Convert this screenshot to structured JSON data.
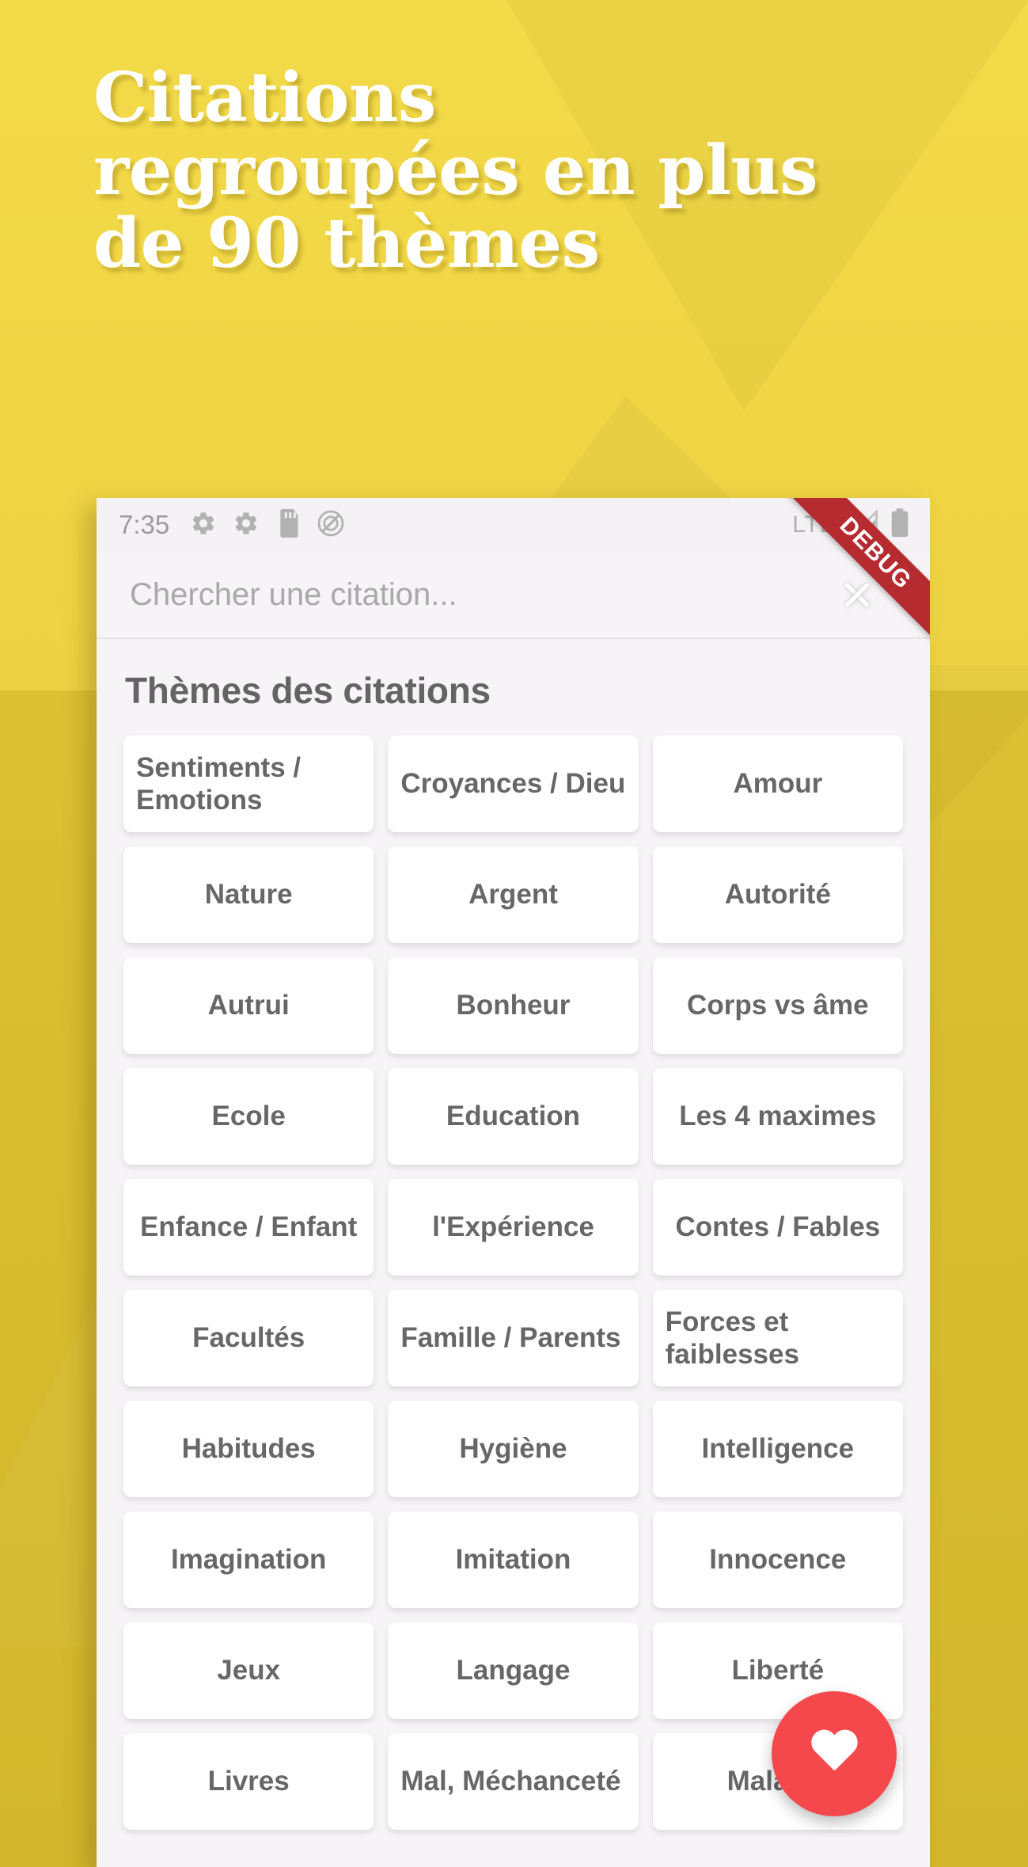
{
  "promo": {
    "headline_lines": [
      "Citations",
      "regroupées en plus",
      "de 90 thèmes"
    ],
    "bg_top_color": "#f0d645",
    "bg_bottom_color": "#d7bc2f",
    "headline_color": "#ffffff"
  },
  "statusbar": {
    "time": "7:35",
    "icons_left": [
      "gear-icon",
      "gear-icon",
      "sd-card-icon",
      "do-not-disturb-icon"
    ],
    "network_label": "LTE",
    "icons_right": [
      "signal-icon",
      "battery-icon"
    ]
  },
  "ribbon": {
    "label": "DEBUG",
    "color": "#b52b30"
  },
  "search": {
    "placeholder": "Chercher une citation...",
    "value": "",
    "clear_icon": "close-icon"
  },
  "main": {
    "section_title": "Thèmes des citations",
    "themes": [
      {
        "label": "Sentiments / Emotions",
        "multiline": true
      },
      {
        "label": "Croyances / Dieu",
        "multiline": true
      },
      {
        "label": "Amour",
        "multiline": false
      },
      {
        "label": "Nature",
        "multiline": false
      },
      {
        "label": "Argent",
        "multiline": false
      },
      {
        "label": "Autorité",
        "multiline": false
      },
      {
        "label": "Autrui",
        "multiline": false
      },
      {
        "label": "Bonheur",
        "multiline": false
      },
      {
        "label": "Corps vs âme",
        "multiline": false
      },
      {
        "label": "Ecole",
        "multiline": false
      },
      {
        "label": "Education",
        "multiline": false
      },
      {
        "label": "Les 4 maximes",
        "multiline": false
      },
      {
        "label": "Enfance / Enfant",
        "multiline": false
      },
      {
        "label": "l'Expérience",
        "multiline": false
      },
      {
        "label": "Contes / Fables",
        "multiline": false
      },
      {
        "label": "Facultés",
        "multiline": false
      },
      {
        "label": "Famille / Parents",
        "multiline": true
      },
      {
        "label": "Forces et faiblesses",
        "multiline": true
      },
      {
        "label": "Habitudes",
        "multiline": false
      },
      {
        "label": "Hygiène",
        "multiline": false
      },
      {
        "label": "Intelligence",
        "multiline": false
      },
      {
        "label": "Imagination",
        "multiline": false
      },
      {
        "label": "Imitation",
        "multiline": false
      },
      {
        "label": "Innocence",
        "multiline": false
      },
      {
        "label": "Jeux",
        "multiline": false
      },
      {
        "label": "Langage",
        "multiline": false
      },
      {
        "label": "Liberté",
        "multiline": false
      },
      {
        "label": "Livres",
        "multiline": false
      },
      {
        "label": "Mal, Méchanceté",
        "multiline": true
      },
      {
        "label": "Maladie",
        "multiline": false
      }
    ]
  },
  "fab": {
    "icon": "heart-icon",
    "color": "#f4484c"
  }
}
